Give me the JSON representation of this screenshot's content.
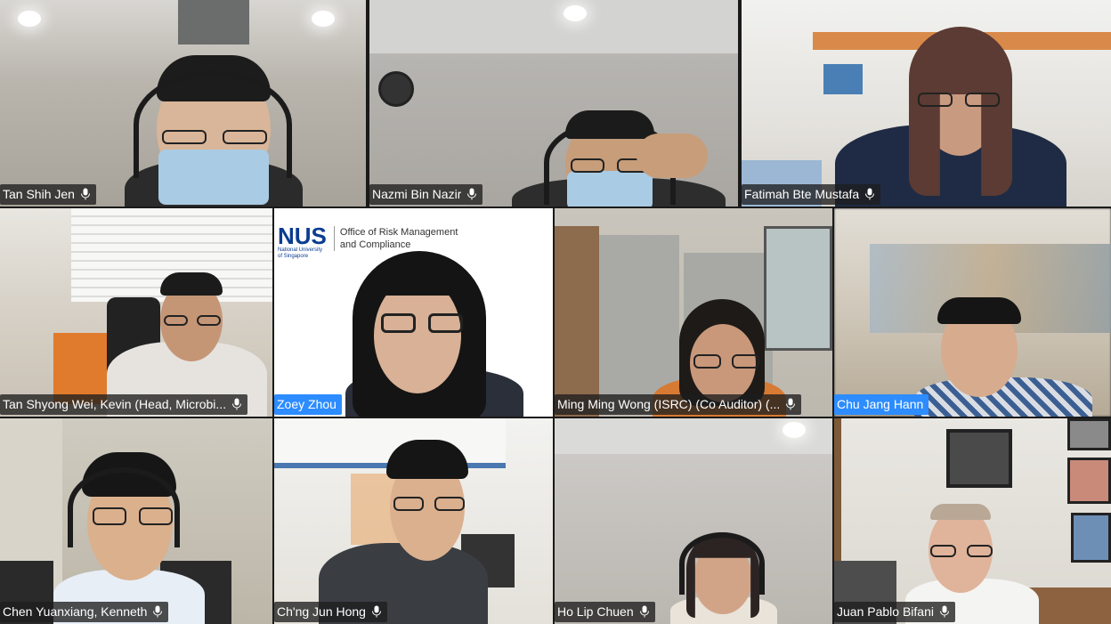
{
  "participants": [
    {
      "name": "Tan Shih Jen",
      "active": false
    },
    {
      "name": "Nazmi Bin Nazir",
      "active": false
    },
    {
      "name": "Fatimah Bte Mustafa",
      "active": false
    },
    {
      "name": "Tan Shyong Wei, Kevin (Head, Microbi...",
      "active": false
    },
    {
      "name": "Zoey Zhou",
      "active": true
    },
    {
      "name": "Ming Ming Wong (ISRC) (Co Auditor) (...",
      "active": false
    },
    {
      "name": "Chu Jang Hann",
      "active": true
    },
    {
      "name": "Chen Yuanxiang, Kenneth",
      "active": false
    },
    {
      "name": "Ch'ng Jun Hong",
      "active": false
    },
    {
      "name": "Ho Lip Chuen",
      "active": false
    },
    {
      "name": "Juan Pablo Bifani",
      "active": false
    }
  ],
  "logo": {
    "brand": "NUS",
    "brand_sub_1": "National University",
    "brand_sub_2": "of Singapore",
    "office_line_1": "Office of Risk Management",
    "office_line_2": "and Compliance"
  },
  "colors": {
    "active_nameplate": "#2d8cff",
    "nameplate": "#1e1e1e"
  },
  "icons": {
    "mic": "microphone-icon"
  }
}
